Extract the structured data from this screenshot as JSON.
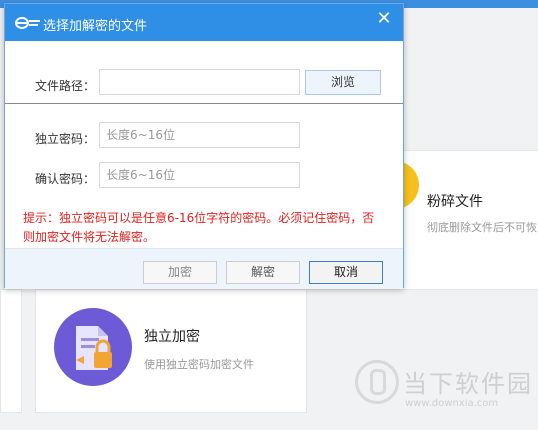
{
  "dialog": {
    "title": "选择加解密的文件",
    "path_label": "文件路径：",
    "path_value": "",
    "browse_label": "浏览",
    "password_label": "独立密码：",
    "password_placeholder": "长度6~16位",
    "confirm_label": "确认密码：",
    "confirm_placeholder": "长度6~16位",
    "hint": "提示：独立密码可以是任意6-16位字符的密码。必须记住密码，否则加密文件将无法解密。",
    "encrypt_label": "加密",
    "decrypt_label": "解密",
    "cancel_label": "取消",
    "close_icon": "close-icon"
  },
  "background": {
    "shred_title": "粉碎文件",
    "shred_desc": "彻底删除文件后不可恢复",
    "encrypt_title": "独立加密",
    "encrypt_desc": "使用独立密码加密文件"
  },
  "watermark": {
    "text": "当下软件园",
    "url": "www.downxia.com"
  },
  "colors": {
    "titlebar": "#2f8ee6",
    "hint": "#e0201c",
    "shred_circle": "#f7c11b",
    "encrypt_circle": "#6c5ad6"
  }
}
